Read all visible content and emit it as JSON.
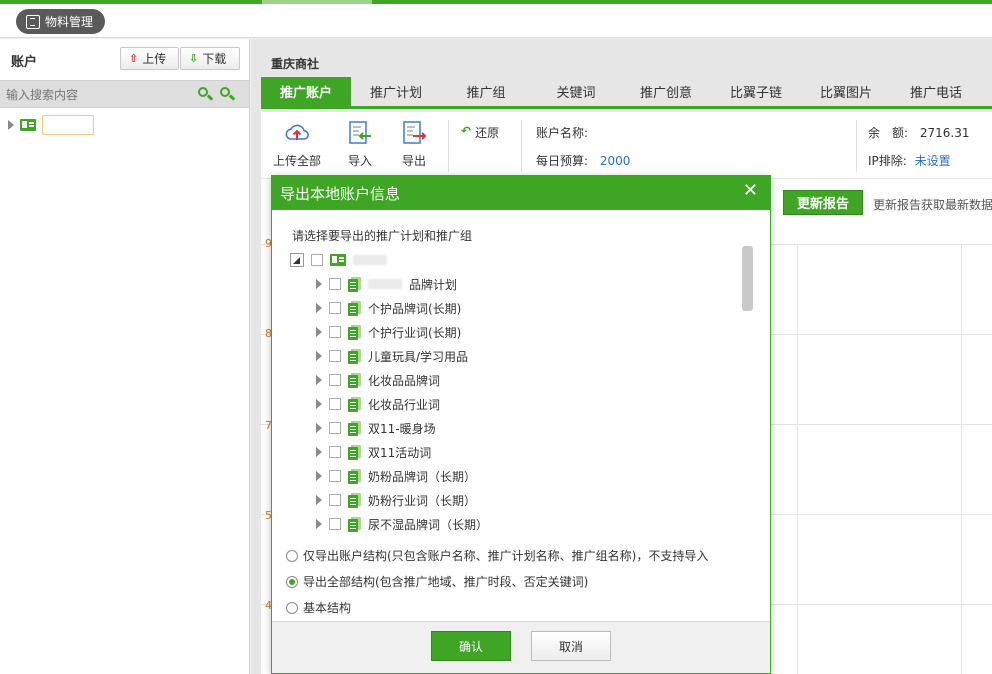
{
  "app": {
    "title": "物料管理"
  },
  "left": {
    "title": "账户",
    "upload_label": "上传",
    "download_label": "下载",
    "search_placeholder": "输入搜索内容"
  },
  "main": {
    "breadcrumb": "重庆商社",
    "tabs": [
      {
        "label": "推广账户",
        "active": true
      },
      {
        "label": "推广计划"
      },
      {
        "label": "推广组"
      },
      {
        "label": "关键词"
      },
      {
        "label": "推广创意"
      },
      {
        "label": "比翼子链"
      },
      {
        "label": "比翼图片"
      },
      {
        "label": "推广电话"
      }
    ],
    "toolbar": {
      "upload_all": "上传全部",
      "import": "导入",
      "export": "导出",
      "restore": "还原"
    },
    "account": {
      "name_label": "账户名称:",
      "budget_label": "每日预算:",
      "budget_value": "2000",
      "balance_label": "余　额:",
      "balance_value": "2716.31",
      "ip_label": "IP排除:",
      "ip_value": "未设置"
    },
    "chart": {
      "update_button": "更新报告",
      "update_note": "更新报告获取最新数据",
      "y_ticks": [
        "9",
        "8",
        "7",
        "5",
        "4"
      ]
    }
  },
  "dialog": {
    "title": "导出本地账户信息",
    "close": "✕",
    "prompt": "请选择要导出的推广计划和推广组",
    "plans": [
      {
        "label": "品牌计划"
      },
      {
        "label": "个护品牌词(长期)"
      },
      {
        "label": "个护行业词(长期)"
      },
      {
        "label": "儿童玩具/学习用品"
      },
      {
        "label": "化妆品品牌词"
      },
      {
        "label": "化妆品行业词"
      },
      {
        "label": "双11-暖身场"
      },
      {
        "label": "双11活动词"
      },
      {
        "label": "奶粉品牌词（长期）"
      },
      {
        "label": "奶粉行业词（长期）"
      },
      {
        "label": "尿不湿品牌词（长期）"
      }
    ],
    "options": [
      {
        "label": "仅导出账户结构(只包含账户名称、推广计划名称、推广组名称)，不支持导入",
        "checked": false
      },
      {
        "label": "导出全部结构(包含推广地域、推广时段、否定关键词)",
        "checked": true
      },
      {
        "label": "基本结构",
        "checked": false
      }
    ],
    "ok_label": "确认",
    "cancel_label": "取消"
  }
}
